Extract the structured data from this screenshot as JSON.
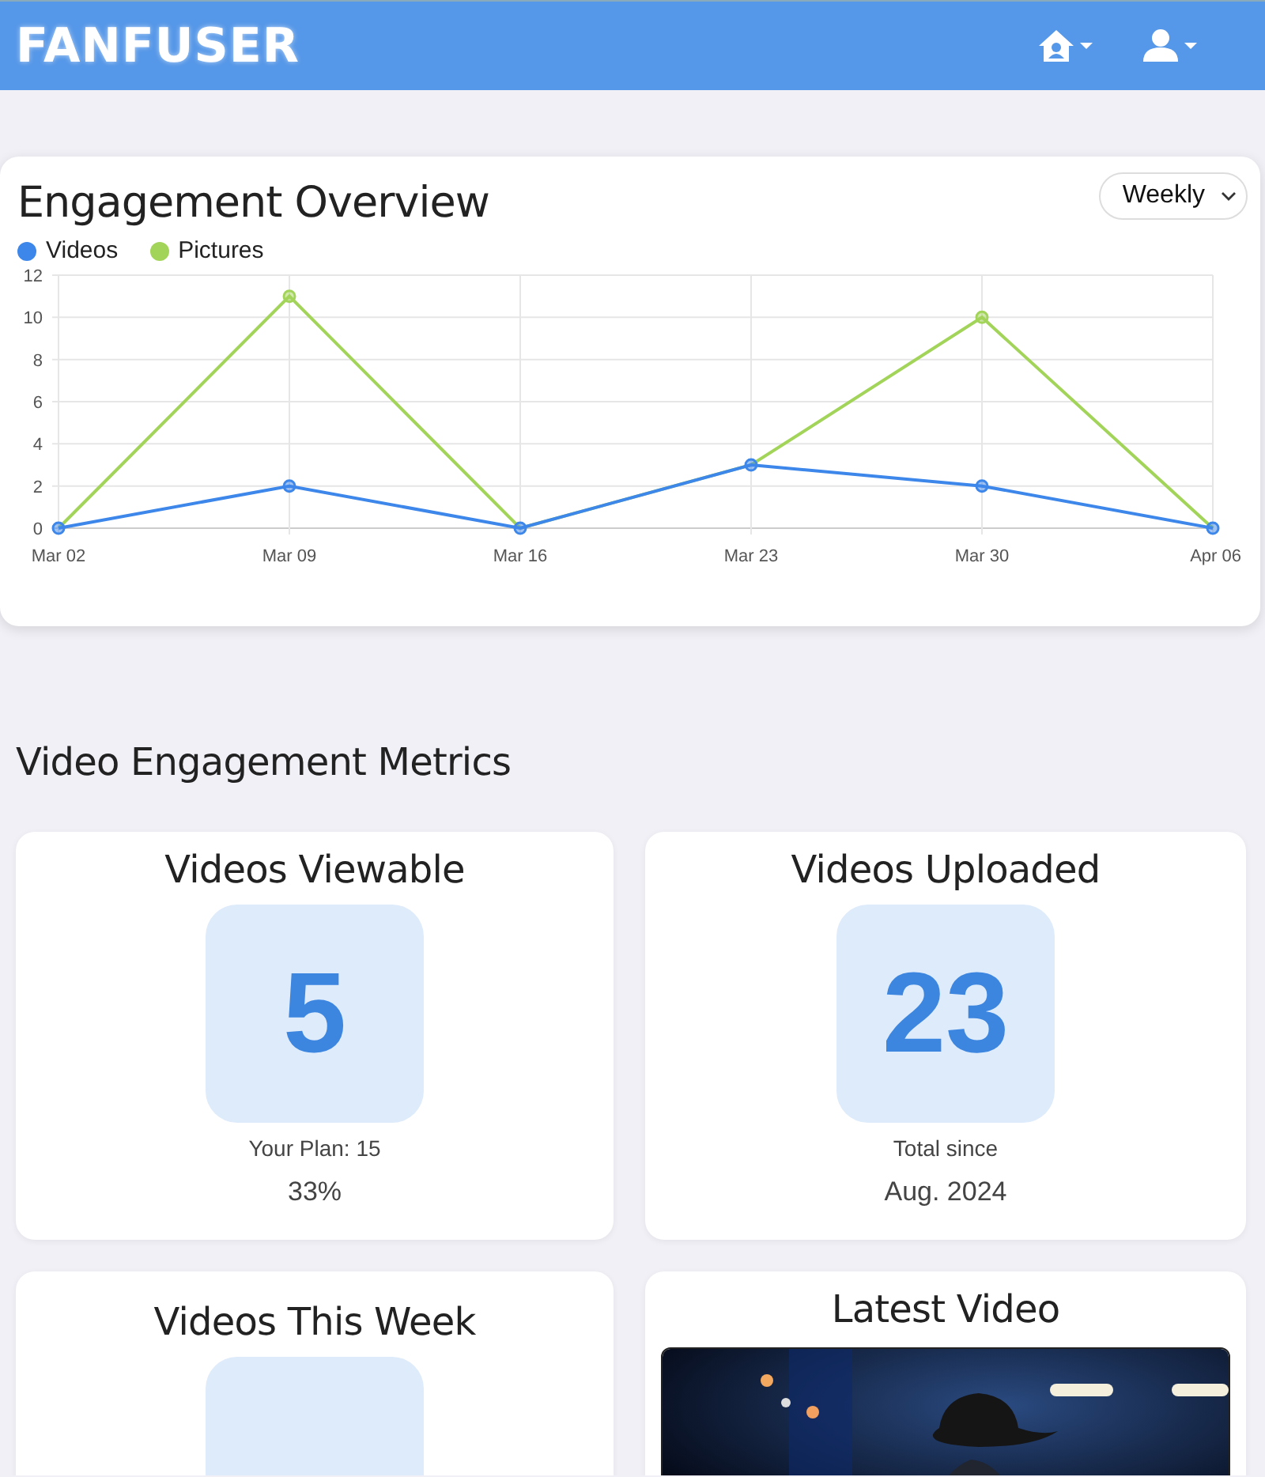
{
  "header": {
    "logo": "FANFUSER"
  },
  "engagement": {
    "title": "Engagement Overview",
    "period_select": {
      "value": "Weekly"
    },
    "chart_data": {
      "type": "line",
      "categories": [
        "Mar 02",
        "Mar 09",
        "Mar 16",
        "Mar 23",
        "Mar 30",
        "Apr 06"
      ],
      "series": [
        {
          "name": "Videos",
          "color": "#3d86ea",
          "marker": true,
          "values": [
            0,
            2,
            0,
            3,
            2,
            0
          ]
        },
        {
          "name": "Pictures",
          "color": "#a3d45a",
          "marker": true,
          "values": [
            0,
            11,
            0,
            3,
            10,
            0
          ]
        }
      ],
      "ylim": [
        0,
        12
      ],
      "yticks": [
        0,
        2,
        4,
        6,
        8,
        10,
        12
      ],
      "grid": true
    }
  },
  "video_metrics": {
    "title": "Video Engagement Metrics",
    "cards": [
      {
        "kind": "stat",
        "title": "Videos Viewable",
        "value": "5",
        "caption": "Your Plan: 15",
        "detail": "33%"
      },
      {
        "kind": "stat",
        "title": "Videos Uploaded",
        "value": "23",
        "caption": "Total since",
        "detail": "Aug. 2024"
      },
      {
        "kind": "stat",
        "title": "Videos This Week"
      },
      {
        "kind": "video",
        "title": "Latest Video"
      }
    ]
  }
}
